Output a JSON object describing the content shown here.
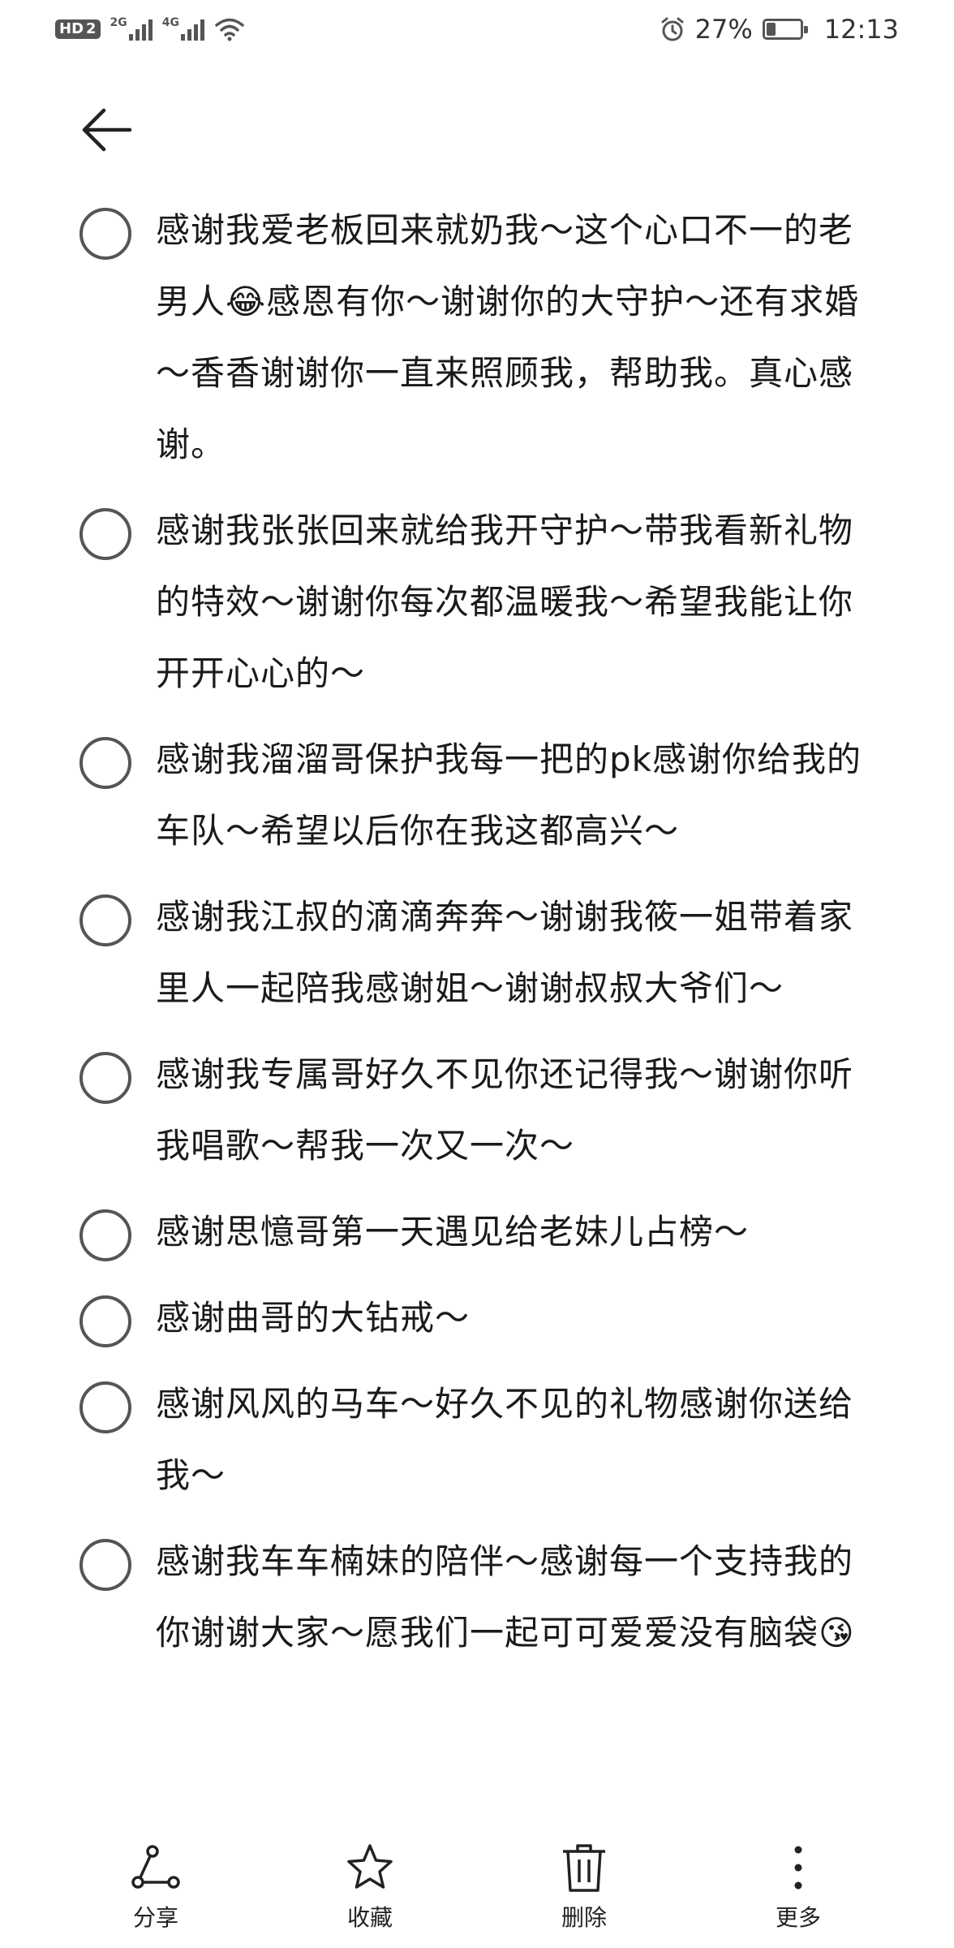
{
  "status_bar": {
    "hd": "HD",
    "hd_sub": "2",
    "net1": "2G",
    "net2": "4G",
    "battery_percent": "27%",
    "battery_level": 0.27,
    "time": "12:13",
    "icons": [
      "hd-icon",
      "signal-2g-icon",
      "signal-4g-icon",
      "wifi-icon",
      "alarm-icon",
      "battery-icon"
    ]
  },
  "header": {
    "back_icon": "arrow-left-icon"
  },
  "checklist": [
    {
      "text": "感谢我爱老板回来就奶我～这个心口不一的老男人😂感恩有你～谢谢你的大守护～还有求婚～香香谢谢你一直来照顾我，帮助我。真心感谢。",
      "checked": false
    },
    {
      "text": "感谢我张张回来就给我开守护～带我看新礼物的特效～谢谢你每次都温暖我～希望我能让你开开心心的～",
      "checked": false
    },
    {
      "text": "感谢我溜溜哥保护我每一把的pk感谢你给我的车队～希望以后你在我这都高兴～",
      "checked": false
    },
    {
      "text": "感谢我江叔的滴滴奔奔～谢谢我筱一姐带着家里人一起陪我感谢姐～谢谢叔叔大爷们～",
      "checked": false
    },
    {
      "text": "感谢我专属哥好久不见你还记得我～谢谢你听我唱歌～帮我一次又一次～",
      "checked": false
    },
    {
      "text": "感谢思憶哥第一天遇见给老妹儿占榜～",
      "checked": false
    },
    {
      "text": "感谢曲哥的大钻戒～",
      "checked": false
    },
    {
      "text": "感谢风风的马车～好久不见的礼物感谢你送给我～",
      "checked": false
    },
    {
      "text": "感谢我车车楠妹的陪伴～感谢每一个支持我的你谢谢大家～愿我们一起可可爱爱没有脑袋😘",
      "checked": false
    }
  ],
  "toolbar": {
    "share": "分享",
    "favorite": "收藏",
    "delete": "删除",
    "more": "更多"
  }
}
